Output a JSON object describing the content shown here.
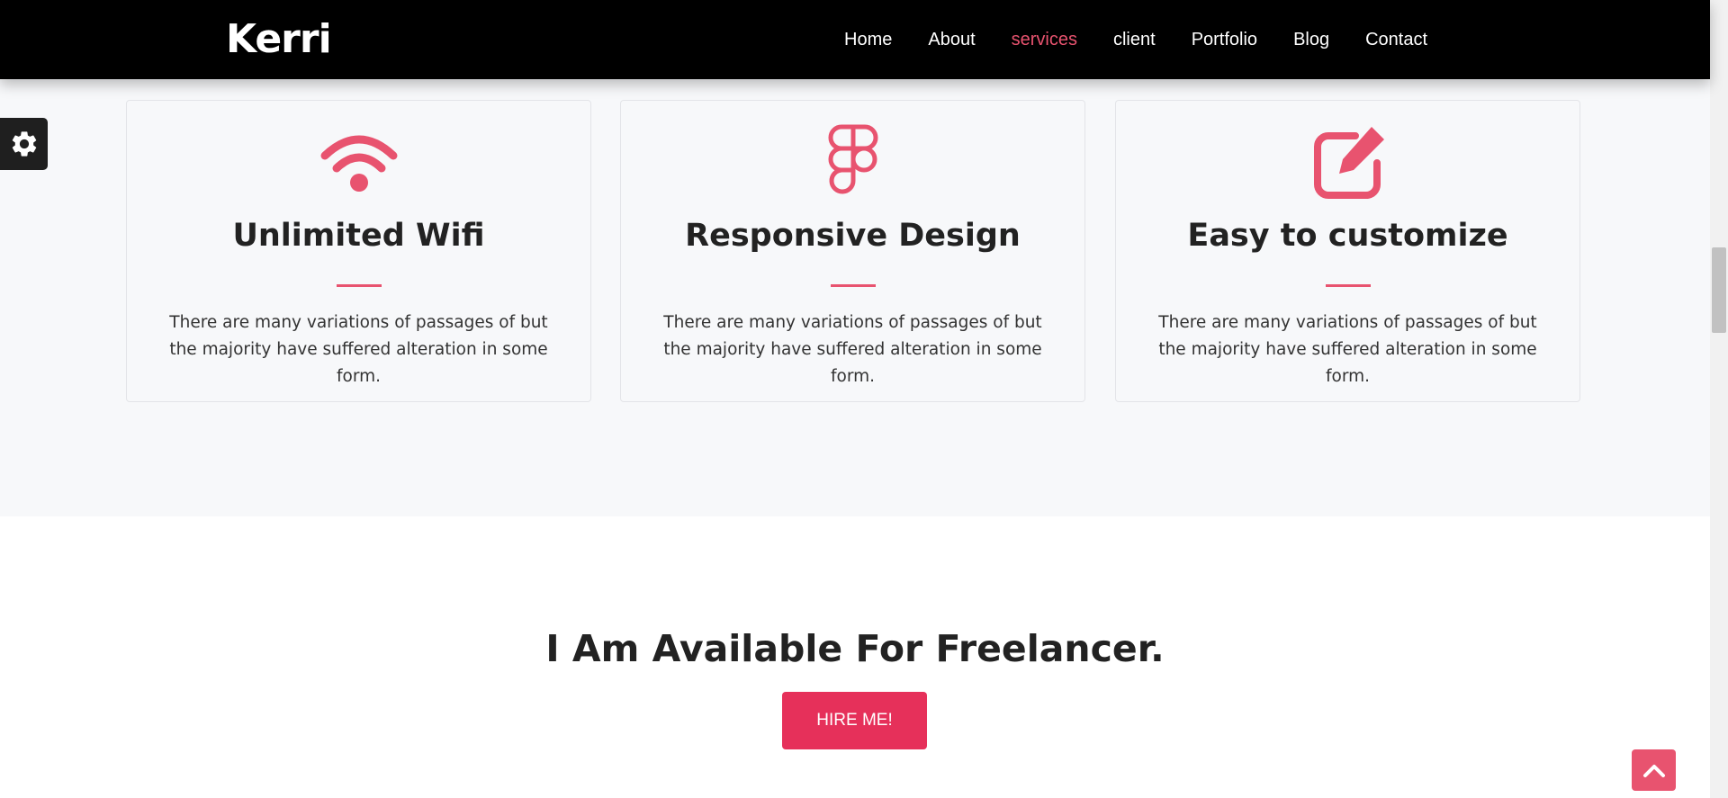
{
  "brand": {
    "logo": "Kerri",
    "accent_color": "#e8536f",
    "button_color": "#e6305a"
  },
  "nav": {
    "items": [
      {
        "label": "Home",
        "active": false
      },
      {
        "label": "About",
        "active": false
      },
      {
        "label": "services",
        "active": true
      },
      {
        "label": "client",
        "active": false
      },
      {
        "label": "Portfolio",
        "active": false
      },
      {
        "label": "Blog",
        "active": false
      },
      {
        "label": "Contact",
        "active": false
      }
    ]
  },
  "services": {
    "cards": [
      {
        "icon": "wifi-icon",
        "title": "Unlimited Wifi",
        "text": "There are many variations of passages of but the majority have suffered alteration in some form."
      },
      {
        "icon": "figma-icon",
        "title": "Responsive Design",
        "text": "There are many variations of passages of but the majority have suffered alteration in some form."
      },
      {
        "icon": "edit-icon",
        "title": "Easy to customize",
        "text": "There are many variations of passages of but the majority have suffered alteration in some form."
      }
    ]
  },
  "settings": {
    "icon": "gear-icon"
  },
  "freelancer": {
    "title": "I Am Available For Freelancer.",
    "button_label": "HIRE ME!"
  },
  "scroll_top": {
    "icon": "chevron-up-icon"
  }
}
